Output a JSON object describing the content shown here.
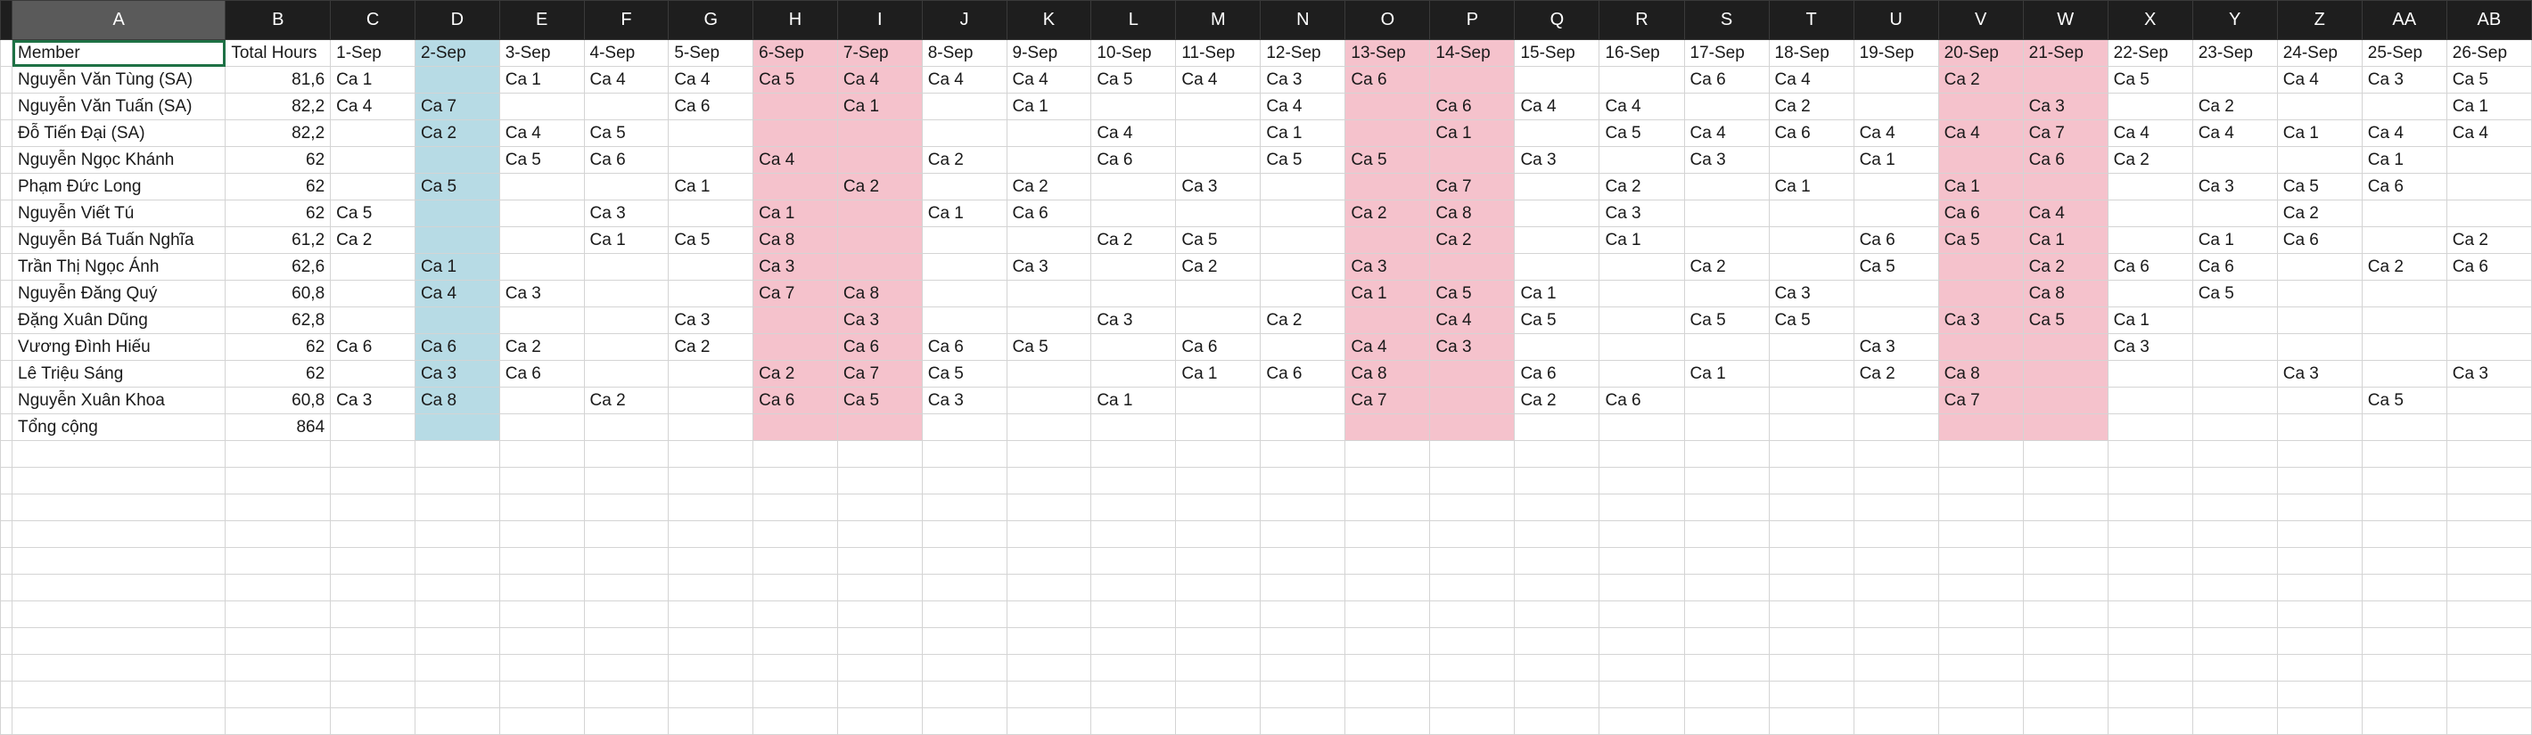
{
  "sheet": {
    "columns": [
      "A",
      "B",
      "C",
      "D",
      "E",
      "F",
      "G",
      "H",
      "I",
      "J",
      "K",
      "L",
      "M",
      "N",
      "O",
      "P",
      "Q",
      "R",
      "S",
      "T",
      "U",
      "V",
      "W",
      "X",
      "Y",
      "Z",
      "AA",
      "AB"
    ],
    "header_row": [
      "Member",
      "Total Hours",
      "1-Sep",
      "2-Sep",
      "3-Sep",
      "4-Sep",
      "5-Sep",
      "6-Sep",
      "7-Sep",
      "8-Sep",
      "9-Sep",
      "10-Sep",
      "11-Sep",
      "12-Sep",
      "13-Sep",
      "14-Sep",
      "15-Sep",
      "16-Sep",
      "17-Sep",
      "18-Sep",
      "19-Sep",
      "20-Sep",
      "21-Sep",
      "22-Sep",
      "23-Sep",
      "24-Sep",
      "25-Sep",
      "26-Sep"
    ],
    "rows": [
      [
        "Nguyễn Văn Tùng (SA)",
        "81,6",
        "Ca 1",
        "",
        "Ca 1",
        "Ca 4",
        "Ca 4",
        "Ca 5",
        "Ca 4",
        "Ca 4",
        "Ca 4",
        "Ca 5",
        "Ca 4",
        "Ca 3",
        "Ca 6",
        "",
        "",
        "",
        "Ca 6",
        "Ca 4",
        "",
        "Ca 2",
        "",
        "Ca 5",
        "",
        "Ca 4",
        "Ca 3",
        "Ca 5"
      ],
      [
        "Nguyễn Văn Tuấn (SA)",
        "82,2",
        "Ca 4",
        "Ca 7",
        "",
        "",
        "Ca 6",
        "",
        "Ca 1",
        "",
        "Ca 1",
        "",
        "",
        "Ca 4",
        "",
        "Ca 6",
        "Ca 4",
        "Ca 4",
        "",
        "Ca 2",
        "",
        "",
        "Ca 3",
        "",
        "Ca 2",
        "",
        "",
        "Ca 1"
      ],
      [
        "Đỗ Tiến Đại (SA)",
        "82,2",
        "",
        "Ca 2",
        "Ca 4",
        "Ca 5",
        "",
        "",
        "",
        "",
        "",
        "Ca 4",
        "",
        "Ca 1",
        "",
        "Ca 1",
        "",
        "Ca 5",
        "Ca 4",
        "Ca 6",
        "Ca 4",
        "Ca 4",
        "Ca 7",
        "Ca 4",
        "Ca 4",
        "Ca 1",
        "Ca 4",
        "Ca 4"
      ],
      [
        "Nguyễn Ngọc Khánh",
        "62",
        "",
        "",
        "Ca 5",
        "Ca 6",
        "",
        "Ca 4",
        "",
        "Ca 2",
        "",
        "Ca 6",
        "",
        "Ca 5",
        "Ca 5",
        "",
        "Ca 3",
        "",
        "Ca 3",
        "",
        "Ca 1",
        "",
        "Ca 6",
        "Ca 2",
        "",
        "",
        "Ca 1",
        ""
      ],
      [
        "Phạm Đức Long",
        "62",
        "",
        "Ca 5",
        "",
        "",
        "Ca 1",
        "",
        "Ca 2",
        "",
        "Ca 2",
        "",
        "Ca 3",
        "",
        "",
        "Ca 7",
        "",
        "Ca 2",
        "",
        "Ca 1",
        "",
        "Ca 1",
        "",
        "",
        "Ca 3",
        "Ca 5",
        "Ca 6",
        ""
      ],
      [
        "Nguyễn Viết Tú",
        "62",
        "Ca 5",
        "",
        "",
        "Ca 3",
        "",
        "Ca 1",
        "",
        "Ca 1",
        "Ca 6",
        "",
        "",
        "",
        "Ca 2",
        "Ca 8",
        "",
        "Ca 3",
        "",
        "",
        "",
        "Ca 6",
        "Ca 4",
        "",
        "",
        "Ca 2",
        "",
        ""
      ],
      [
        "Nguyễn Bá Tuấn Nghĩa",
        "61,2",
        "Ca 2",
        "",
        "",
        "Ca 1",
        "Ca 5",
        "Ca 8",
        "",
        "",
        "",
        "Ca 2",
        "Ca 5",
        "",
        "",
        "Ca 2",
        "",
        "Ca 1",
        "",
        "",
        "Ca 6",
        "Ca 5",
        "Ca 1",
        "",
        "Ca 1",
        "Ca 6",
        "",
        "Ca 2"
      ],
      [
        "Trần Thị Ngọc Ánh",
        "62,6",
        "",
        "Ca 1",
        "",
        "",
        "",
        "Ca 3",
        "",
        "",
        "Ca 3",
        "",
        "Ca 2",
        "",
        "Ca 3",
        "",
        "",
        "",
        "Ca 2",
        "",
        "Ca 5",
        "",
        "Ca 2",
        "Ca 6",
        "Ca 6",
        "",
        "Ca 2",
        "Ca 6"
      ],
      [
        "Nguyễn Đăng Quý",
        "60,8",
        "",
        "Ca 4",
        "Ca 3",
        "",
        "",
        "Ca 7",
        "Ca 8",
        "",
        "",
        "",
        "",
        "",
        "Ca 1",
        "Ca 5",
        "Ca 1",
        "",
        "",
        "Ca 3",
        "",
        "",
        "Ca 8",
        "",
        "Ca 5",
        "",
        "",
        ""
      ],
      [
        "Đặng Xuân Dũng",
        "62,8",
        "",
        "",
        "",
        "",
        "Ca 3",
        "",
        "Ca 3",
        "",
        "",
        "Ca 3",
        "",
        "Ca 2",
        "",
        "Ca 4",
        "Ca 5",
        "",
        "Ca 5",
        "Ca 5",
        "",
        "Ca 3",
        "Ca 5",
        "Ca 1",
        "",
        "",
        "",
        ""
      ],
      [
        "Vương Đình Hiếu",
        "62",
        "Ca 6",
        "Ca 6",
        "Ca 2",
        "",
        "Ca 2",
        "",
        "Ca 6",
        "Ca 6",
        "Ca 5",
        "",
        "Ca 6",
        "",
        "Ca 4",
        "Ca 3",
        "",
        "",
        "",
        "",
        "Ca 3",
        "",
        "",
        "Ca 3",
        "",
        "",
        "",
        ""
      ],
      [
        "Lê Triệu Sáng",
        "62",
        "",
        "Ca 3",
        "Ca 6",
        "",
        "",
        "Ca 2",
        "Ca 7",
        "Ca 5",
        "",
        "",
        "Ca 1",
        "Ca 6",
        "Ca 8",
        "",
        "Ca 6",
        "",
        "Ca 1",
        "",
        "Ca 2",
        "Ca 8",
        "",
        "",
        "",
        "Ca 3",
        "",
        "Ca 3"
      ],
      [
        "Nguyễn Xuân Khoa",
        "60,8",
        "Ca 3",
        "Ca 8",
        "",
        "Ca 2",
        "",
        "Ca 6",
        "Ca 5",
        "Ca 3",
        "",
        "Ca 1",
        "",
        "",
        "Ca 7",
        "",
        "Ca 2",
        "Ca 6",
        "",
        "",
        "",
        "Ca 7",
        "",
        "",
        "",
        "",
        "Ca 5",
        ""
      ],
      [
        "Tổng cộng",
        "864",
        "",
        "",
        "",
        "",
        "",
        "",
        "",
        "",
        "",
        "",
        "",
        "",
        "",
        "",
        "",
        "",
        "",
        "",
        "",
        "",
        "",
        "",
        "",
        "",
        "",
        ""
      ]
    ],
    "empty_rows": 11,
    "selected_cell": "A1",
    "colors": {
      "blue_highlight": "#b7dbe5",
      "pink_highlight": "#f5c2cc",
      "header_bg": "#1e1e1e",
      "selection": "#1e7145"
    }
  }
}
